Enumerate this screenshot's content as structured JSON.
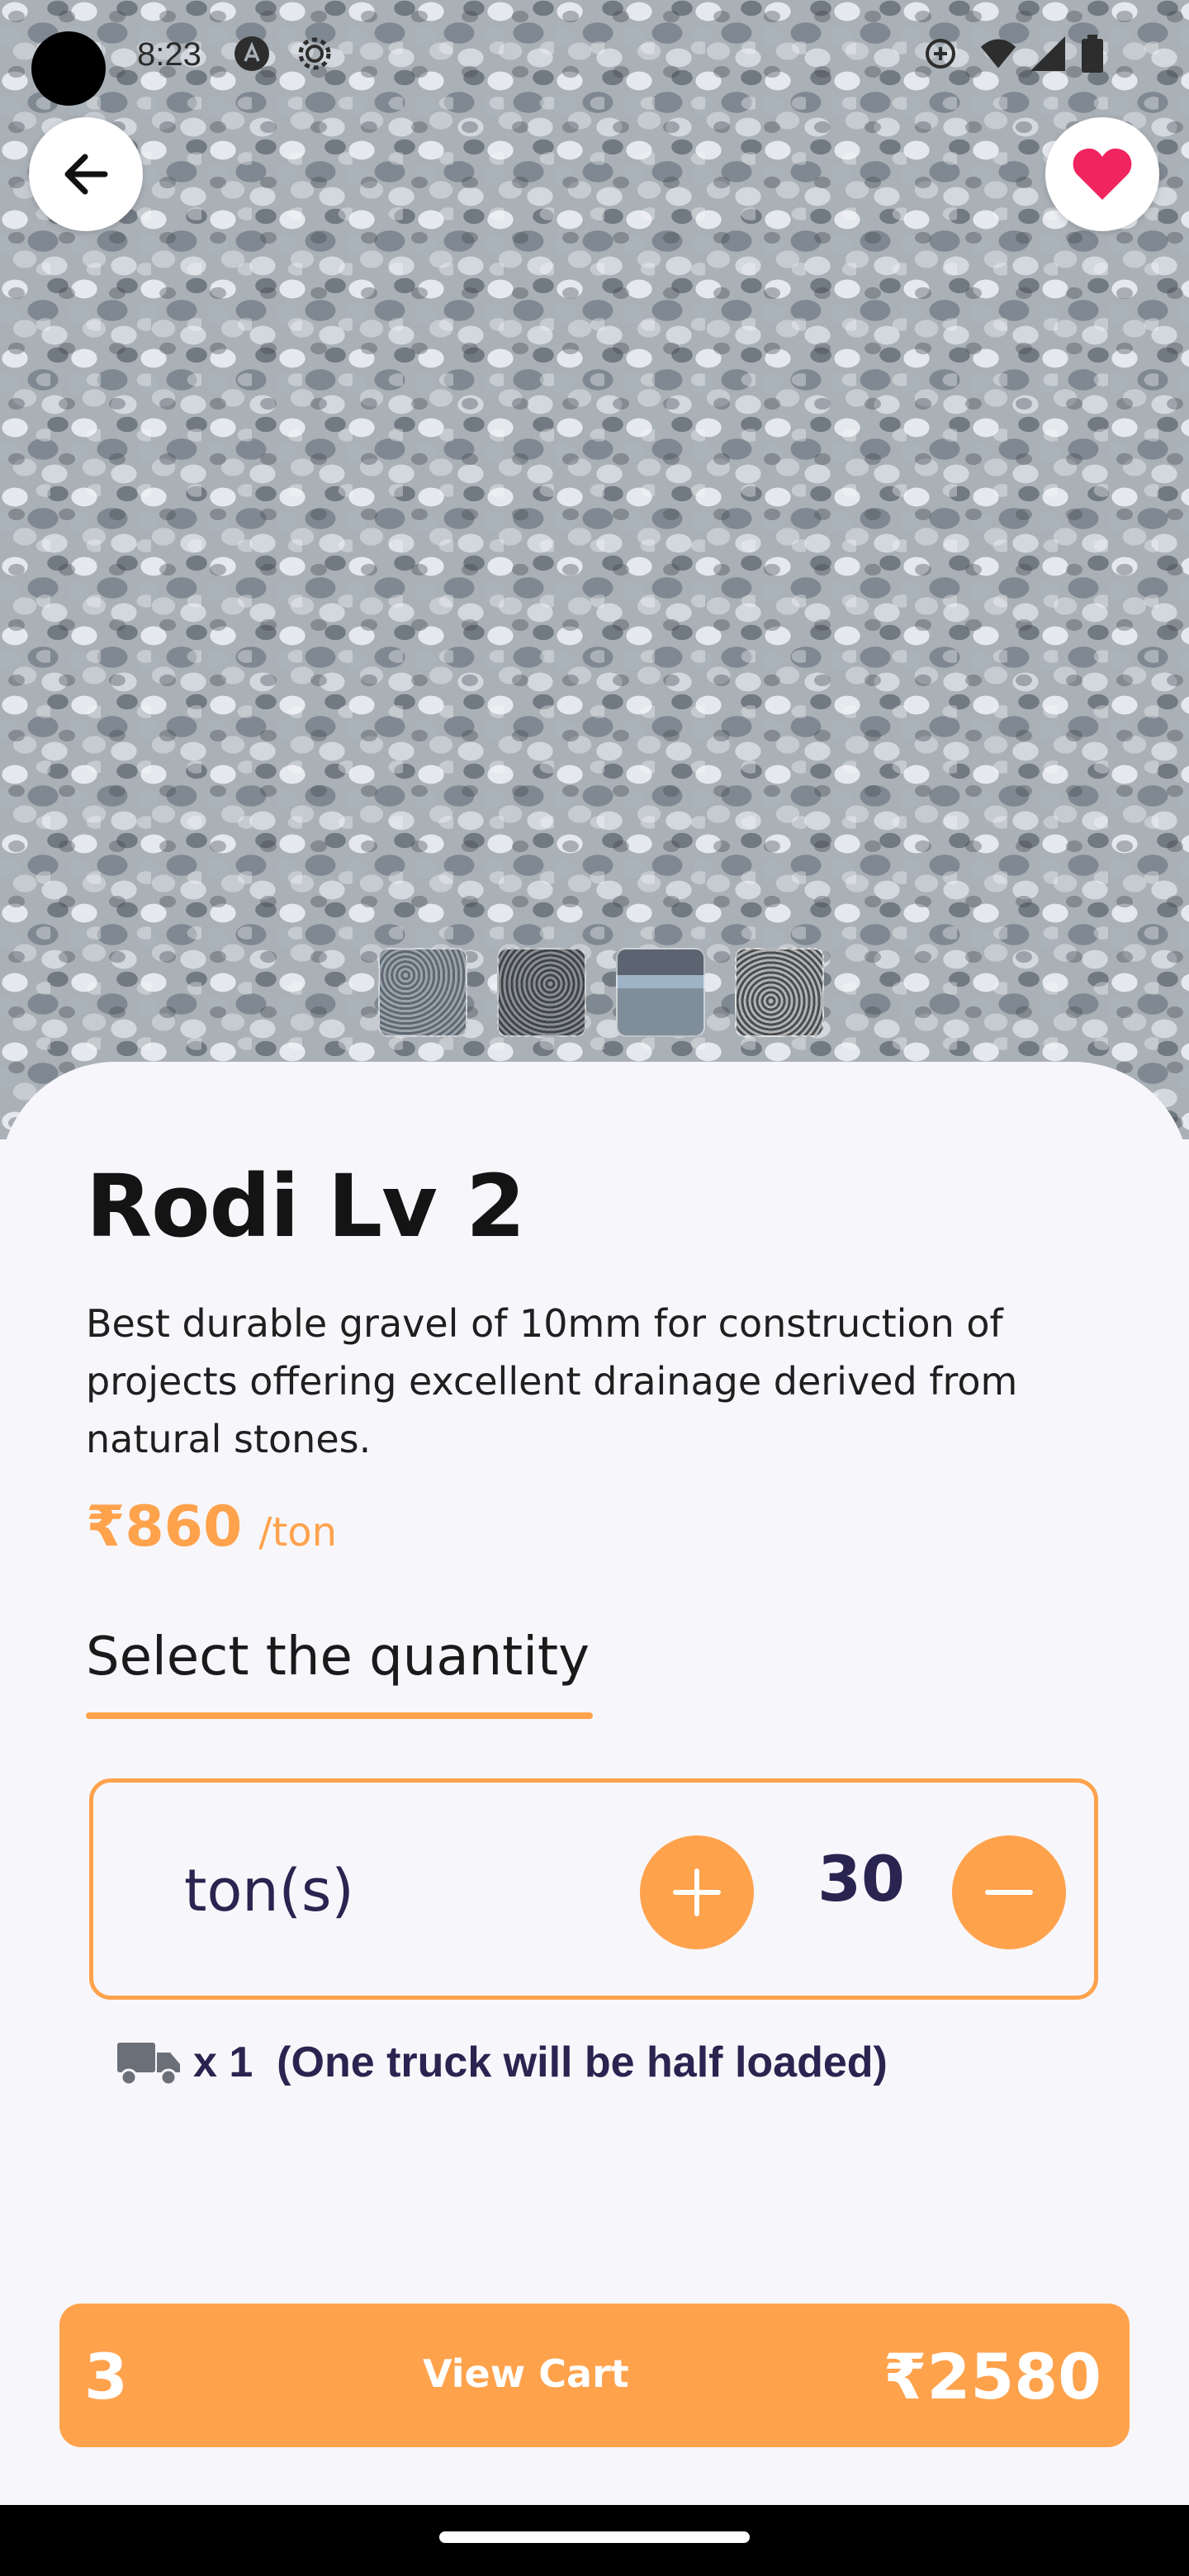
{
  "status_bar": {
    "time": "8:23",
    "icons": [
      "notification-a-icon",
      "settings-gear-icon",
      "data-saver-icon",
      "wifi-icon",
      "signal-icon",
      "battery-icon"
    ]
  },
  "header": {
    "back_icon": "arrow-left-icon",
    "favorite_icon": "heart-icon"
  },
  "gallery": {
    "thumbnail_count": 4
  },
  "product": {
    "title": "Rodi Lv 2",
    "description": "Best durable gravel of 10mm for construction of projects offering excellent drainage derived from natural stones.",
    "price": "₹860",
    "price_unit": "/ton"
  },
  "quantity": {
    "heading": "Select the quantity",
    "unit": "ton(s)",
    "value": "30"
  },
  "truck_info": {
    "text": "x 1  (One truck will be half loaded)"
  },
  "cart": {
    "count": "3",
    "label": "View Cart",
    "total": "₹2580"
  },
  "colors": {
    "accent": "#ffa24c",
    "text_dark": "#141414",
    "text_navy": "#2a2450",
    "favorite": "#f0245f"
  }
}
